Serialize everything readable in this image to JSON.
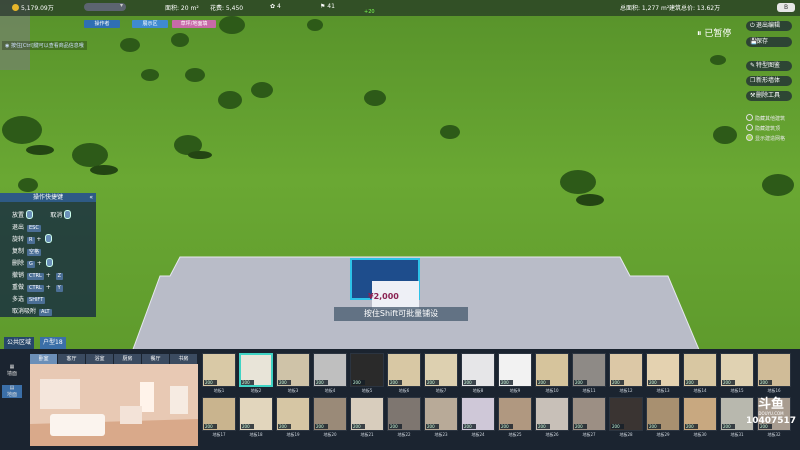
{
  "topbar": {
    "money": "5,179.09万",
    "area": "面积: 20 m²",
    "cost": "花费: 5,450",
    "stat1": "4",
    "stat2": "41",
    "plus": "+20",
    "total_area": "总面积: 1,277 m²",
    "total_value": "建筑总价: 13.62万",
    "toggle": "B"
  },
  "mode_buttons": [
    "操作者",
    "展示区",
    "草坪/地面填"
  ],
  "tip_text": "按住[Ctrl]键可以查看商品信息哦",
  "status": "已暂停",
  "right_buttons": [
    {
      "icon": "⏻",
      "label": "退出编辑"
    },
    {
      "icon": "💾",
      "label": "保存"
    },
    {
      "icon": "✎",
      "label": "特型图鉴"
    },
    {
      "icon": "❐",
      "label": "新形墙体"
    },
    {
      "icon": "⚒",
      "label": "删除工具"
    }
  ],
  "checkboxes": [
    {
      "label": "隐藏其他建筑",
      "checked": false
    },
    {
      "label": "隐藏建筑顶",
      "checked": false
    },
    {
      "label": "显示建造网格",
      "checked": true
    }
  ],
  "shortcuts": {
    "title": "操作快捷键",
    "rows": [
      {
        "label": "放置",
        "keys": [],
        "mouse": true,
        "label2": "取消",
        "mouse2": true
      },
      {
        "label": "退出",
        "keys": [
          "ESC"
        ]
      },
      {
        "label": "旋转",
        "keys": [
          "R"
        ],
        "mouse": true
      },
      {
        "label": "复制",
        "keys": [
          "空格"
        ]
      },
      {
        "label": "删除",
        "keys": [
          "G"
        ],
        "mouse": true
      },
      {
        "label": "撤销",
        "keys": [
          "CTRL",
          "Z"
        ]
      },
      {
        "label": "重做",
        "keys": [
          "CTRL",
          "Y"
        ]
      },
      {
        "label": "多选",
        "keys": [
          "SHIFT"
        ]
      },
      {
        "label": "取消吸附",
        "keys": [
          "ALT"
        ]
      }
    ]
  },
  "overlay": {
    "price": "¥2,000",
    "shift_tip": "按住Shift可批量铺设"
  },
  "region": {
    "label": "公共区域",
    "type": "户型18"
  },
  "side_tools": [
    "墙面",
    "地面"
  ],
  "room_tabs": [
    "卧室",
    "客厅",
    "浴室",
    "厨房",
    "餐厅",
    "书房"
  ],
  "tiles": [
    {
      "name": "地板1",
      "price": "200",
      "color": "#d9c9a6"
    },
    {
      "name": "地板2",
      "price": "200",
      "color": "#e8e4d8",
      "selected": true
    },
    {
      "name": "地板3",
      "price": "200",
      "color": "#cfc3a8"
    },
    {
      "name": "地板4",
      "price": "200",
      "color": "#bfbfbf"
    },
    {
      "name": "地板5",
      "price": "200",
      "color": "#2a2a2a"
    },
    {
      "name": "地板6",
      "price": "200",
      "color": "#d8c8a4"
    },
    {
      "name": "地板7",
      "price": "200",
      "color": "#ddd0b0"
    },
    {
      "name": "地板8",
      "price": "200",
      "color": "#e6e6e8"
    },
    {
      "name": "地板9",
      "price": "200",
      "color": "#f2f2f2"
    },
    {
      "name": "地板10",
      "price": "200",
      "color": "#d6c49c"
    },
    {
      "name": "地板11",
      "price": "200",
      "color": "#8e8a86"
    },
    {
      "name": "地板12",
      "price": "200",
      "color": "#dcc8a6"
    },
    {
      "name": "地板13",
      "price": "200",
      "color": "#e4d2b0"
    },
    {
      "name": "地板14",
      "price": "200",
      "color": "#d8c7a2"
    },
    {
      "name": "地板15",
      "price": "200",
      "color": "#e0d2b2"
    },
    {
      "name": "地板16",
      "price": "200",
      "color": "#d0bc98"
    },
    {
      "name": "地板17",
      "price": "200",
      "color": "#c9b48e"
    },
    {
      "name": "地板18",
      "price": "200",
      "color": "#e2d6bd"
    },
    {
      "name": "地板19",
      "price": "200",
      "color": "#d6c6a4"
    },
    {
      "name": "地板20",
      "price": "200",
      "color": "#9a8a78"
    },
    {
      "name": "地板21",
      "price": "200",
      "color": "#d8cdbd"
    },
    {
      "name": "地板22",
      "price": "200",
      "color": "#7e7670"
    },
    {
      "name": "地板23",
      "price": "200",
      "color": "#b8aa98"
    },
    {
      "name": "地板24",
      "price": "200",
      "color": "#cfc8d8"
    },
    {
      "name": "地板25",
      "price": "200",
      "color": "#b09880"
    },
    {
      "name": "地板26",
      "price": "200",
      "color": "#c8c0b8"
    },
    {
      "name": "地板27",
      "price": "200",
      "color": "#9c8f84"
    },
    {
      "name": "地板28",
      "price": "200",
      "color": "#3a3432"
    },
    {
      "name": "地板29",
      "price": "200",
      "color": "#a89070"
    },
    {
      "name": "地板30",
      "price": "200",
      "color": "#c8a880"
    },
    {
      "name": "地板31",
      "price": "200",
      "color": "#b8b8ae"
    },
    {
      "name": "地板32",
      "price": "200",
      "color": "#a89c90"
    }
  ],
  "watermark": {
    "logo": "斗鱼",
    "sub": "DOUYU.COM",
    "room": "10407517"
  }
}
